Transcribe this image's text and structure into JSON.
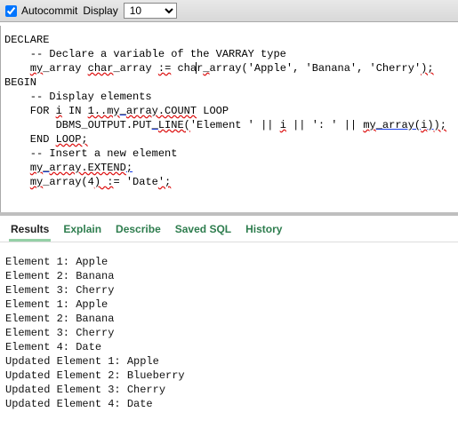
{
  "toolbar": {
    "autocommit_label": "Autocommit",
    "autocommit_checked": true,
    "display_label": "Display",
    "display_value": "10"
  },
  "editor": {
    "lines": [
      {
        "segments": [
          {
            "t": "",
            "cls": ""
          }
        ],
        "indent": 0
      },
      {
        "segments": [
          {
            "t": "DECLARE",
            "cls": ""
          }
        ],
        "indent": 0
      },
      {
        "segments": [
          {
            "t": "-- Declare a variable of the VARRAY type",
            "cls": ""
          }
        ],
        "indent": 4
      },
      {
        "segments": [
          {
            "t": "my",
            "cls": "sq-red"
          },
          {
            "t": "_array ",
            "cls": ""
          },
          {
            "t": "char",
            "cls": "sq-red"
          },
          {
            "t": "_array ",
            "cls": ""
          },
          {
            "t": ":=",
            "cls": "sq-red"
          },
          {
            "t": " cha",
            "cls": ""
          },
          {
            "t": "|",
            "cls": "caretmark"
          },
          {
            "t": "r",
            "cls": ""
          },
          {
            "t": "_",
            "cls": "sq-red"
          },
          {
            "t": "array('Apple', 'Banana', 'Cherry'",
            "cls": ""
          },
          {
            "t": ");",
            "cls": "u-blue sq-red"
          }
        ],
        "indent": 4
      },
      {
        "segments": [
          {
            "t": "",
            "cls": ""
          }
        ],
        "indent": 0
      },
      {
        "segments": [
          {
            "t": "BEGIN",
            "cls": ""
          }
        ],
        "indent": 0
      },
      {
        "segments": [
          {
            "t": "-- Display elements",
            "cls": ""
          }
        ],
        "indent": 4
      },
      {
        "segments": [
          {
            "t": "FOR ",
            "cls": ""
          },
          {
            "t": "i",
            "cls": "u-blue sq-red"
          },
          {
            "t": " IN ",
            "cls": ""
          },
          {
            "t": "1..my",
            "cls": "u-blue sq-red"
          },
          {
            "t": "_",
            "cls": "u-blue"
          },
          {
            "t": "array.COUNT",
            "cls": "u-blue sq-red"
          },
          {
            "t": " LOOP",
            "cls": ""
          }
        ],
        "indent": 4
      },
      {
        "segments": [
          {
            "t": "DBMS_OUTPUT.PUT",
            "cls": ""
          },
          {
            "t": "_",
            "cls": "u-blue"
          },
          {
            "t": "LINE(",
            "cls": "u-blue sq-red"
          },
          {
            "t": "'Element ' || ",
            "cls": ""
          },
          {
            "t": "i",
            "cls": "u-blue sq-red"
          },
          {
            "t": " || ': ' || ",
            "cls": ""
          },
          {
            "t": "my",
            "cls": "sq-red"
          },
          {
            "t": "_array(",
            "cls": "u-blue"
          },
          {
            "t": "i",
            "cls": "u-blue sq-red"
          },
          {
            "t": ")",
            "cls": "u-blue"
          },
          {
            "t": ");",
            "cls": "u-blue sq-red"
          }
        ],
        "indent": 8
      },
      {
        "segments": [
          {
            "t": "END ",
            "cls": ""
          },
          {
            "t": "LOOP;",
            "cls": "u-blue sq-red"
          }
        ],
        "indent": 4
      },
      {
        "segments": [
          {
            "t": "",
            "cls": ""
          }
        ],
        "indent": 0
      },
      {
        "segments": [
          {
            "t": "-- Insert a new element",
            "cls": ""
          }
        ],
        "indent": 4
      },
      {
        "segments": [
          {
            "t": "my",
            "cls": "sq-red"
          },
          {
            "t": "_",
            "cls": "u-blue"
          },
          {
            "t": "array.EXTEND",
            "cls": "u-blue sq-red"
          },
          {
            "t": ";",
            "cls": "u-blue"
          }
        ],
        "indent": 4
      },
      {
        "segments": [
          {
            "t": "my",
            "cls": "sq-red"
          },
          {
            "t": "_array(4",
            "cls": ""
          },
          {
            "t": ") :",
            "cls": "u-blue sq-red"
          },
          {
            "t": "= 'Date",
            "cls": ""
          },
          {
            "t": "';",
            "cls": "u-blue sq-red"
          }
        ],
        "indent": 4
      }
    ]
  },
  "tabs": {
    "items": [
      {
        "label": "Results",
        "active": true
      },
      {
        "label": "Explain",
        "active": false
      },
      {
        "label": "Describe",
        "active": false
      },
      {
        "label": "Saved SQL",
        "active": false
      },
      {
        "label": "History",
        "active": false
      }
    ]
  },
  "results": {
    "lines": [
      "Element 1: Apple",
      "Element 2: Banana",
      "Element 3: Cherry",
      "Element 1: Apple",
      "Element 2: Banana",
      "Element 3: Cherry",
      "Element 4: Date",
      "Updated Element 1: Apple",
      "Updated Element 2: Blueberry",
      "Updated Element 3: Cherry",
      "Updated Element 4: Date"
    ]
  }
}
